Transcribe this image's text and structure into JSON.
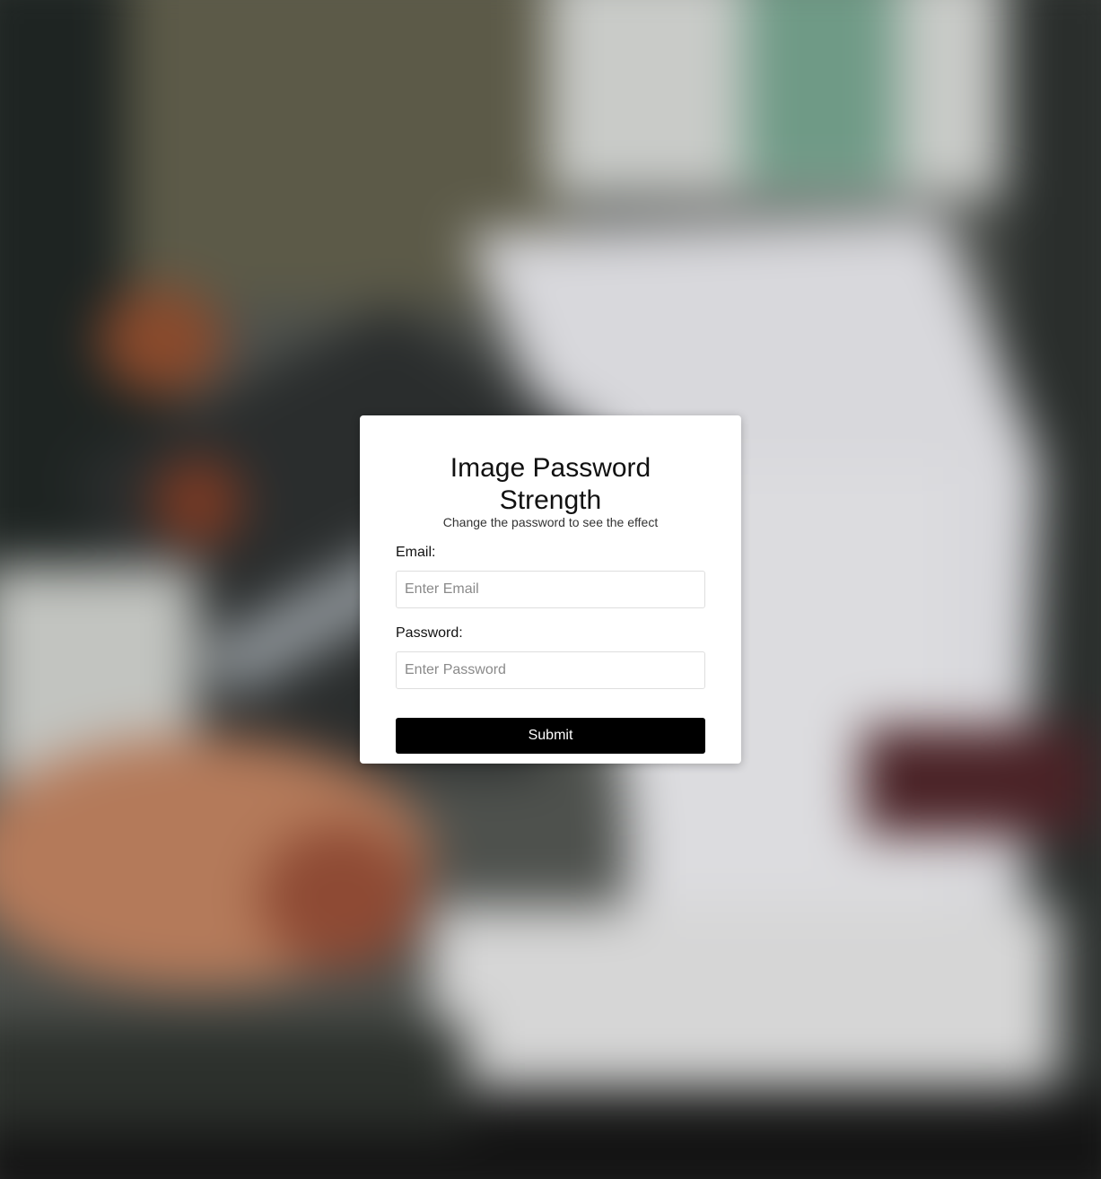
{
  "form": {
    "title": "Image Password Strength",
    "subtitle": "Change the password to see the effect",
    "email_label": "Email:",
    "email_placeholder": "Enter Email",
    "email_value": "",
    "password_label": "Password:",
    "password_placeholder": "Enter Password",
    "password_value": "",
    "submit_label": "Submit"
  },
  "colors": {
    "card_background": "#ffffff",
    "button_background": "#000000",
    "button_text": "#ffffff"
  }
}
